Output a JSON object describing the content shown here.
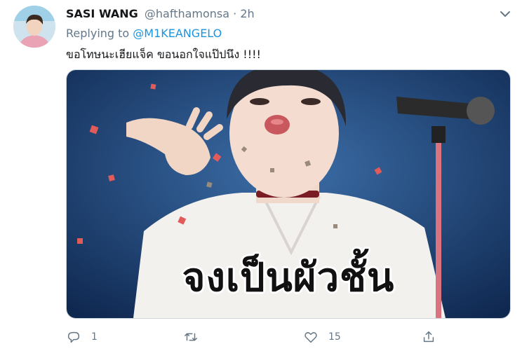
{
  "tweet": {
    "author_name": "SASI WANG",
    "handle": "@hafthamonsa",
    "separator": "·",
    "time": "2h",
    "replying_prefix": "Replying to",
    "replying_to": "@M1KEANGELO",
    "text": "ขอโทษนะเฮียแจ็ค ขอนอกใจแป๊ปนึง !!!!",
    "image_caption": "จงเป็นผัวชั้น"
  },
  "actions": {
    "reply_count": "1",
    "retweet_count": "",
    "like_count": "15"
  },
  "colors": {
    "link": "#1b95e0",
    "secondary_text": "#657786",
    "primary_text": "#14171a"
  },
  "icons": [
    "caret-down-icon",
    "reply-icon",
    "retweet-icon",
    "heart-icon",
    "share-icon"
  ]
}
